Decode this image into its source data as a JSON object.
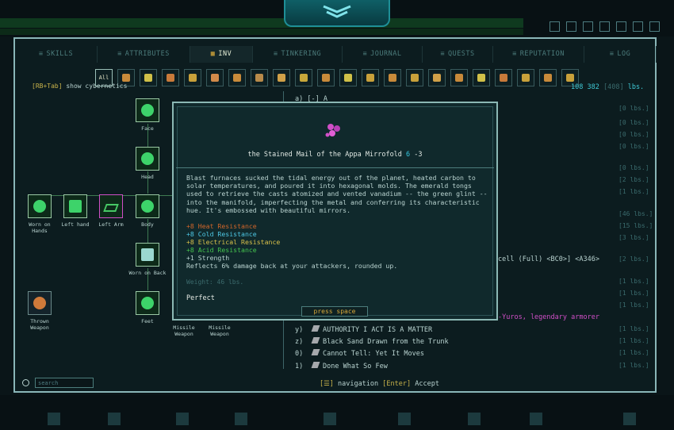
{
  "tabs": [
    {
      "label": "SKILLS",
      "active": false
    },
    {
      "label": "ATTRIBUTES",
      "active": false
    },
    {
      "label": "INV",
      "active": true
    },
    {
      "label": "TINKERING",
      "active": false
    },
    {
      "label": "JOURNAL",
      "active": false
    },
    {
      "label": "QUESTS",
      "active": false
    },
    {
      "label": "REPUTATION",
      "active": false
    },
    {
      "label": "LOG",
      "active": false
    }
  ],
  "filter": {
    "all_label": "All"
  },
  "hint": {
    "key": "[RB+Tab]",
    "text": " show cybernetics"
  },
  "weight": {
    "current": "108",
    "max": "382",
    "max_dim": "408",
    "unit": "lbs."
  },
  "equipment": [
    {
      "label": "Face"
    },
    {
      "label": "Head"
    },
    {
      "label": "Worn on Hands"
    },
    {
      "label": "Left hand"
    },
    {
      "label": "Left Arm"
    },
    {
      "label": "Body"
    },
    {
      "label": "Worn on Back"
    },
    {
      "label": "Thrown Weapon"
    },
    {
      "label": "Feet"
    },
    {
      "label": "Missile Weapon"
    },
    {
      "label": "Missile Weapon"
    }
  ],
  "list_header": "a) [-] A",
  "list_header_weight": "[0 lbs.]",
  "list_weights": [
    "[0 lbs.]",
    "[0 lbs.]",
    "[0 lbs.]",
    "[0 lbs.]",
    "[0 lbs.]",
    "[2 lbs.]",
    "[1 lbs.]",
    "[46 lbs.]",
    "[15 lbs.]",
    "[3 lbs.]",
    "[2 lbs.]",
    "[1 lbs.]",
    "[1 lbs.]",
    "[1 lbs.]",
    "[1 lbs.]",
    "[1 lbs.]",
    "[1 lbs.]",
    "[1 lbs.]"
  ],
  "list_partial": {
    "text": "cell (Full) <BC0>] <A346>",
    "legend": "-Yuros, legendary armorer"
  },
  "list_items": [
    {
      "key": "y)",
      "name": "AUTHORITY I ACT IS A MATTER"
    },
    {
      "key": "z)",
      "name": "Black Sand Drawn from the Trunk"
    },
    {
      "key": "0)",
      "name": "Cannot Tell: Yet It Moves"
    },
    {
      "key": "1)",
      "name": "Done What So Few"
    }
  ],
  "popup": {
    "title_pre": "the Stained Mail of the Appa Mirrofold ",
    "title_av": "6",
    "title_dv": " -3",
    "description": "Blast furnaces sucked the tidal energy out of the planet, heated carbon to solar temperatures, and poured it into hexagonal molds. The emerald tongs used to retrieve the casts atomized and vented vanadium -- the green glint -- into the manifold, imperfecting the metal and conferring its characteristic hue. It's embossed with beautiful mirrors.",
    "stats": [
      {
        "text": "+8 Heat Resistance",
        "color": "#d0652a"
      },
      {
        "text": "+8 Cold Resistance",
        "color": "#4ec7e4"
      },
      {
        "text": "+8 Electrical Resistance",
        "color": "#d8c04a"
      },
      {
        "text": "+8 Acid Resistance",
        "color": "#45c34e"
      },
      {
        "text": "+1 Strength",
        "color": "#b9d3d0"
      },
      {
        "text": "Reflects 6% damage back at your attackers, rounded up.",
        "color": "#b9d3d0"
      }
    ],
    "weight": "Weight: 46 lbs.",
    "condition": "Perfect",
    "press_space": "press space"
  },
  "search": {
    "placeholder": "search"
  },
  "nav": {
    "key1": "[☰]",
    "text1": " navigation  ",
    "key2": "[Enter]",
    "text2": " Accept"
  },
  "colors": {
    "accent": "#3fc9d6",
    "frame": "#8ab6b8",
    "key": "#c8b24a"
  }
}
